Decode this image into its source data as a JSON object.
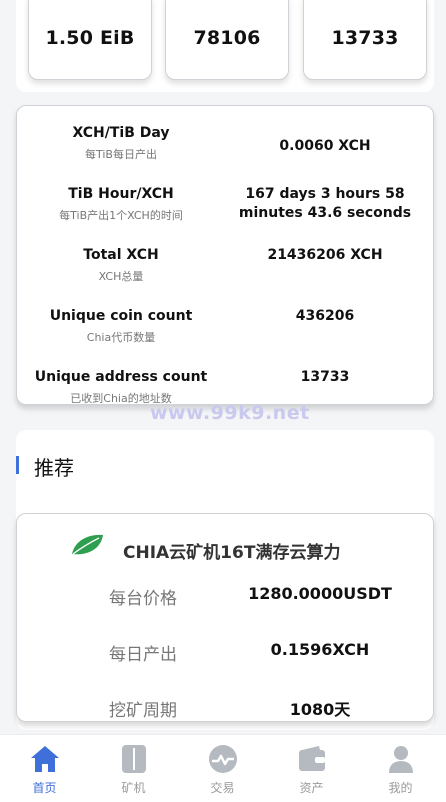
{
  "stats": [
    "1.50 EiB",
    "78106",
    "13733"
  ],
  "info_rows": [
    {
      "title": "XCH/TiB Day",
      "sub": "每TiB每日产出",
      "value": "0.0060 XCH"
    },
    {
      "title": "TiB Hour/XCH",
      "sub": "每TiB产出1个XCH的时间",
      "value": "167 days 3 hours 58 minutes 43.6 seconds"
    },
    {
      "title": "Total XCH",
      "sub": "XCH总量",
      "value": "21436206 XCH"
    },
    {
      "title": "Unique coin count",
      "sub": "Chia代币数量",
      "value": "436206"
    },
    {
      "title": "Unique address count",
      "sub": "已收到Chia的地址数",
      "value": "13733"
    }
  ],
  "watermark": "www.99k9.net",
  "recommend": {
    "title": "推荐",
    "product": {
      "icon": "leaf-icon",
      "name": "CHIA云矿机16T满存云算力",
      "rows": [
        {
          "label": "每台价格",
          "value": "1280.0000USDT"
        },
        {
          "label": "每日产出",
          "value": "0.1596XCH"
        },
        {
          "label": "挖矿周期",
          "value": "1080天"
        }
      ]
    }
  },
  "tabbar": [
    {
      "label": "首页",
      "icon": "home-icon",
      "active": true
    },
    {
      "label": "矿机",
      "icon": "miner-icon",
      "active": false
    },
    {
      "label": "交易",
      "icon": "trade-icon",
      "active": false
    },
    {
      "label": "资产",
      "icon": "wallet-icon",
      "active": false
    },
    {
      "label": "我的",
      "icon": "user-icon",
      "active": false
    }
  ],
  "colors": {
    "accent": "#3f6fd8",
    "leaf": "#2e9e4f",
    "inactive_icon": "#b5b9c0"
  }
}
